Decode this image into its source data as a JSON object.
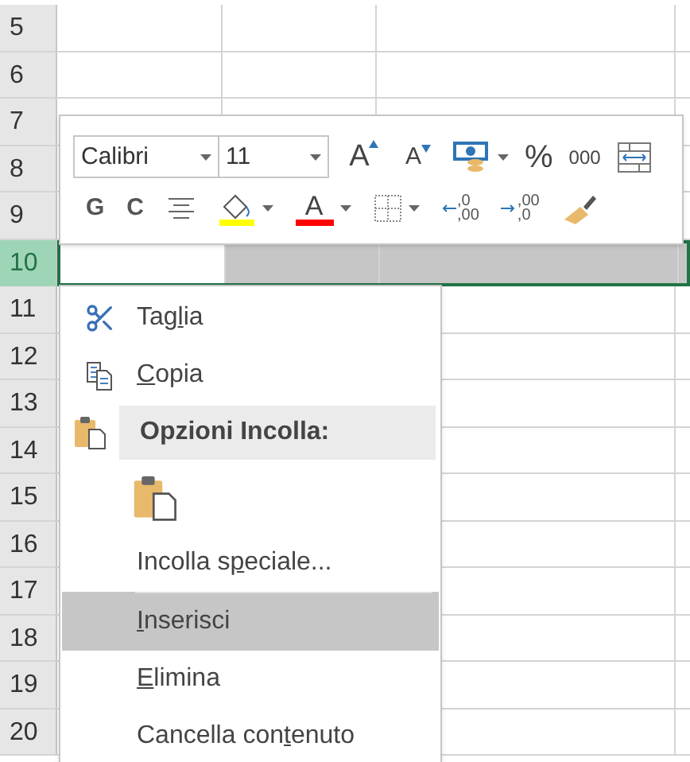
{
  "sheet": {
    "rows": [
      {
        "number": "5",
        "selected": false
      },
      {
        "number": "6",
        "selected": false
      },
      {
        "number": "7",
        "selected": false
      },
      {
        "number": "8",
        "selected": false
      },
      {
        "number": "9",
        "selected": false
      },
      {
        "number": "10",
        "selected": true
      },
      {
        "number": "11",
        "selected": false
      },
      {
        "number": "12",
        "selected": false
      },
      {
        "number": "13",
        "selected": false
      },
      {
        "number": "14",
        "selected": false
      },
      {
        "number": "15",
        "selected": false
      },
      {
        "number": "16",
        "selected": false
      },
      {
        "number": "17",
        "selected": false
      },
      {
        "number": "18",
        "selected": false
      },
      {
        "number": "19",
        "selected": false
      },
      {
        "number": "20",
        "selected": false
      }
    ]
  },
  "mini_toolbar": {
    "font": "Calibri",
    "size": "11",
    "grow_font": "A",
    "shrink_font": "A",
    "percent": "%",
    "thousands": "000",
    "bold": "G",
    "italic": "C",
    "font_color": "A",
    "increase_decimal": {
      "top": ",0",
      "bottom": ",00"
    },
    "decrease_decimal": {
      "top": ",00",
      "bottom": ",0"
    }
  },
  "context_menu": [
    {
      "kind": "command",
      "label": {
        "before": "Tag",
        "key": "l",
        "after": "ia"
      },
      "selected": false,
      "separator_before": false
    },
    {
      "kind": "command",
      "label": {
        "key": "C",
        "after": "opia"
      },
      "selected": false,
      "separator_before": false
    },
    {
      "kind": "heading",
      "text": "Opzioni Incolla:"
    },
    {
      "kind": "paste-options"
    },
    {
      "kind": "command",
      "label": {
        "before": "Incolla s",
        "key": "p",
        "after": "eciale..."
      },
      "selected": false,
      "separator_before": false
    },
    {
      "kind": "command",
      "label": {
        "key": "I",
        "after": "nserisci"
      },
      "selected": true,
      "separator_before": true
    },
    {
      "kind": "command",
      "label": {
        "key": "E",
        "after": "limina"
      },
      "selected": false,
      "separator_before": false
    },
    {
      "kind": "command",
      "label": {
        "before": "Cancella con",
        "key": "t",
        "after": "enuto"
      },
      "selected": false,
      "separator_before": false
    }
  ]
}
